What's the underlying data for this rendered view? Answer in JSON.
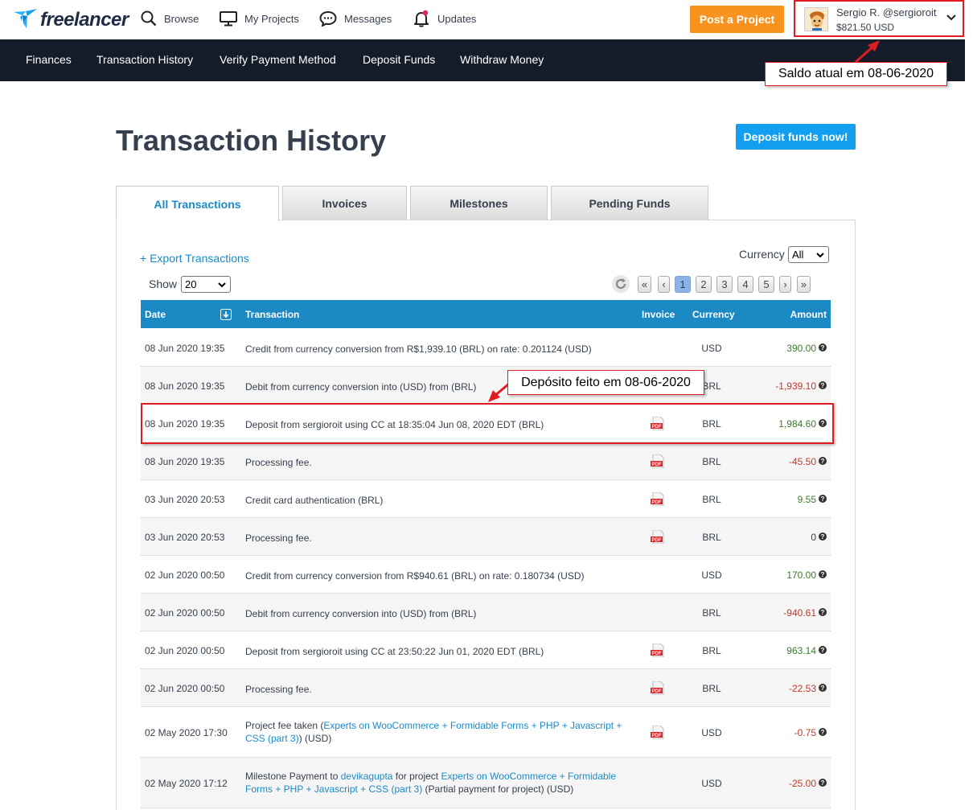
{
  "brand": {
    "name": "freelancer",
    "accent": "#139ff0",
    "post_color": "#f7931e"
  },
  "header": {
    "nav": [
      {
        "label": "Browse",
        "icon": "search-icon"
      },
      {
        "label": "My Projects",
        "icon": "monitor-icon"
      },
      {
        "label": "Messages",
        "icon": "chat-icon"
      },
      {
        "label": "Updates",
        "icon": "bell-icon"
      }
    ],
    "post_project": "Post a Project",
    "user": {
      "name": "Sergio R. @sergioroit",
      "balance": "$821.50 USD"
    }
  },
  "subnav": [
    "Finances",
    "Transaction History",
    "Verify Payment Method",
    "Deposit Funds",
    "Withdraw Money"
  ],
  "annotations": {
    "balance_note": "Saldo atual em 08-06-2020",
    "deposit_note": "Depósito feito em 08-06-2020"
  },
  "page": {
    "title": "Transaction History",
    "deposit_now": "Deposit funds now!"
  },
  "tabs": [
    "All Transactions",
    "Invoices",
    "Milestones",
    "Pending Funds"
  ],
  "controls": {
    "export": "+ Export Transactions",
    "currency_label": "Currency",
    "currency_value": "All",
    "show_label": "Show",
    "show_value": "20"
  },
  "pagination": [
    "«",
    "‹",
    "1",
    "2",
    "3",
    "4",
    "5",
    "›",
    "»"
  ],
  "table": {
    "columns": {
      "date": "Date",
      "transaction": "Transaction",
      "invoice": "Invoice",
      "currency": "Currency",
      "amount": "Amount"
    },
    "rows": [
      {
        "date": "08 Jun 2020 19:35",
        "desc": "Credit from currency conversion from R$1,939.10 (BRL) on rate: 0.201124 (USD)",
        "pdf": false,
        "currency": "USD",
        "amount": "390.00",
        "sign": "pos"
      },
      {
        "date": "08 Jun 2020 19:35",
        "desc": "Debit from currency conversion into (USD) from (BRL)",
        "pdf": false,
        "currency": "BRL",
        "amount": "-1,939.10",
        "sign": "neg"
      },
      {
        "date": "08 Jun 2020 19:35",
        "desc": "Deposit from sergioroit using CC at 18:35:04 Jun 08, 2020 EDT (BRL)",
        "pdf": true,
        "currency": "BRL",
        "amount": "1,984.60",
        "sign": "pos"
      },
      {
        "date": "08 Jun 2020 19:35",
        "desc": "Processing fee.",
        "pdf": true,
        "currency": "BRL",
        "amount": "-45.50",
        "sign": "neg"
      },
      {
        "date": "03 Jun 2020 20:53",
        "desc": "Credit card authentication (BRL)",
        "pdf": true,
        "currency": "BRL",
        "amount": "9.55",
        "sign": "pos"
      },
      {
        "date": "03 Jun 2020 20:53",
        "desc": "Processing fee.",
        "pdf": true,
        "currency": "BRL",
        "amount": "0",
        "sign": "zero"
      },
      {
        "date": "02 Jun 2020 00:50",
        "desc": "Credit from currency conversion from R$940.61 (BRL) on rate: 0.180734 (USD)",
        "pdf": false,
        "currency": "USD",
        "amount": "170.00",
        "sign": "pos"
      },
      {
        "date": "02 Jun 2020 00:50",
        "desc": "Debit from currency conversion into (USD) from (BRL)",
        "pdf": false,
        "currency": "BRL",
        "amount": "-940.61",
        "sign": "neg"
      },
      {
        "date": "02 Jun 2020 00:50",
        "desc": "Deposit from sergioroit using CC at 23:50:22 Jun 01, 2020 EDT (BRL)",
        "pdf": true,
        "currency": "BRL",
        "amount": "963.14",
        "sign": "pos"
      },
      {
        "date": "02 Jun 2020 00:50",
        "desc": "Processing fee.",
        "pdf": true,
        "currency": "BRL",
        "amount": "-22.53",
        "sign": "neg"
      },
      {
        "date": "02 May 2020 17:30",
        "desc_parts": [
          "Project fee taken (",
          "Experts on WooCommerce + Formidable Forms + PHP + Javascript + CSS (part 3)",
          ") (USD)"
        ],
        "pdf": true,
        "currency": "USD",
        "amount": "-0.75",
        "sign": "neg"
      },
      {
        "date": "02 May 2020 17:12",
        "desc_parts": [
          "Milestone Payment to ",
          "devikagupta",
          " for project ",
          "Experts on WooCommerce + Formidable Forms + PHP + Javascript + CSS (part 3)",
          " (Partial payment for project) (USD)"
        ],
        "pdf": false,
        "currency": "USD",
        "amount": "-25.00",
        "sign": "neg"
      }
    ]
  }
}
